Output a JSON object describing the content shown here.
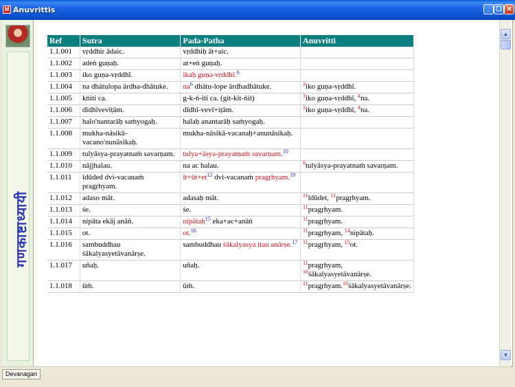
{
  "window": {
    "title": "Anuvrittis",
    "app_icon_text": "M",
    "buttons": {
      "minimize": "_",
      "restore": "❐",
      "close": "✕"
    }
  },
  "side": {
    "title": "गणकाष्टाध्यायी"
  },
  "table": {
    "headers": [
      "Ref",
      "Sutra",
      "Pada-Patha",
      "Anuvritti"
    ],
    "rows": [
      {
        "ref": "1.1.001",
        "sutra": "vṛddhir ādaic.",
        "pada": "vṛddhiḥ āt+aic.",
        "anuvritti": ""
      },
      {
        "ref": "1.1.002",
        "sutra": "adeṅ guṇaḥ.",
        "pada": "at+eṅ guṇaḥ.",
        "anuvritti": ""
      },
      {
        "ref": "1.1.003",
        "sutra": "iko guṇa-vṛddhī.",
        "pada_red": "ikaḥ guṇa-vṛddhī.",
        "pada_sup": "6",
        "anuvritti": ""
      },
      {
        "ref": "1.1.004",
        "sutra": "na dhātulopa ārdha-dhātuke.",
        "pada_red": "na",
        "pada_sup": "6",
        "pada_rest": " dhātu-lope ārdhadhātuke.",
        "anu_sup": "3",
        "anuvritti": "iko guṇa-vṛddhī."
      },
      {
        "ref": "1.1.005",
        "sutra": "kṅiti ca.",
        "pada": "g-k-ṅ-iti ca. (git-kit-ṅit)",
        "anu_sup": "3",
        "anuvritti": "iko guṇa-vṛddhī, ",
        "anu_sup2": "4",
        "anuvritti2": "na."
      },
      {
        "ref": "1.1.006",
        "sutra": "dīdhīvevīṭām.",
        "pada": "dīdhī-vevī+iṭām.",
        "anu_sup": "3",
        "anuvritti": "iko guṇa-vṛddhī, ",
        "anu_sup2": "4",
        "anuvritti2": "na."
      },
      {
        "ref": "1.1.007",
        "sutra": "halo'nantarāḥ saṁyogaḥ.",
        "pada": "halaḥ anantarāḥ saṁyogaḥ.",
        "anuvritti": ""
      },
      {
        "ref": "1.1.008",
        "sutra": "mukha-nāsikā-vacano'nunāsikaḥ.",
        "pada": "mukha-nāsikā-vacanaḥ+anunāsikaḥ.",
        "anuvritti": ""
      },
      {
        "ref": "1.1.009",
        "sutra": "tulyāsya-prayatnaṁ savarṇam.",
        "pada_red": "tulya+āsya-prayatnaṁ savarṇam.",
        "pada_sup": "10",
        "anuvritti": ""
      },
      {
        "ref": "1.1.010",
        "sutra": "nājjhalau.",
        "pada": "na ac halau.",
        "anu_sup": "9",
        "anuvritti": "tulyāsya-prayatnaṁ savarṇam."
      },
      {
        "ref": "1.1.011",
        "sutra": "īdūded dvi-vacanaṁ pragṛhyam.",
        "pada_red": "īt+ūt+et",
        "pada_sup": "12",
        "pada_rest": " dvi-vacanaṁ ",
        "pada_red2": "pragṛhyam.",
        "pada_sup2": "19",
        "anuvritti": ""
      },
      {
        "ref": "1.1.012",
        "sutra": "adaso māt.",
        "pada": "adasaḥ māt.",
        "anu_sup": "11",
        "anuvritti": "īdūdet, ",
        "anu_sup2": "11",
        "anuvritti2": "pragṛhyam."
      },
      {
        "ref": "1.1.013",
        "sutra": "śe.",
        "pada": "śe.",
        "anu_sup": "11",
        "anuvritti": "pragṛhyam."
      },
      {
        "ref": "1.1.014",
        "sutra": "nipāta ekāj anāṅ.",
        "pada_red": "nipātaḥ",
        "pada_sup": "15",
        "pada_rest": " eka+ac+anāṅ",
        "anu_sup": "11",
        "anuvritti": "pragṛhyam."
      },
      {
        "ref": "1.1.015",
        "sutra": "ot.",
        "pada_red": "ot.",
        "pada_sup": "16",
        "anu_sup": "11",
        "anuvritti": "pragṛhyam, ",
        "anu_sup2": "14",
        "anuvritti2": "nipātaḥ."
      },
      {
        "ref": "1.1.016",
        "sutra": "sambuddhau śākalyasyetāvanārṣe.",
        "pada": "sambuddhau ",
        "pada_red2": "śākalyasya itau anārṣe.",
        "pada_sup2": "17",
        "anu_sup": "11",
        "anuvritti": "pragṛhyam, ",
        "anu_sup2": "15",
        "anuvritti2": "ot."
      },
      {
        "ref": "1.1.017",
        "sutra": "uñaḥ.",
        "pada": "uñaḥ.",
        "anu_sup": "11",
        "anuvritti": "pragṛhyam,",
        "anu_sup2": "16",
        "anuvritti2": "śākalyasyetāvanārṣe."
      },
      {
        "ref": "1.1.018",
        "sutra": "ūṁ.",
        "pada": "ūṁ.",
        "anu_sup": "11",
        "anuvritti": "pragṛhyam.",
        "anu_sup2": "16",
        "anuvritti2": "śākalyasyetāvanārṣe."
      }
    ]
  },
  "scrollbar": {
    "up": "▲",
    "down": "▼"
  },
  "bottom_tab": {
    "label": "Devanagari"
  }
}
